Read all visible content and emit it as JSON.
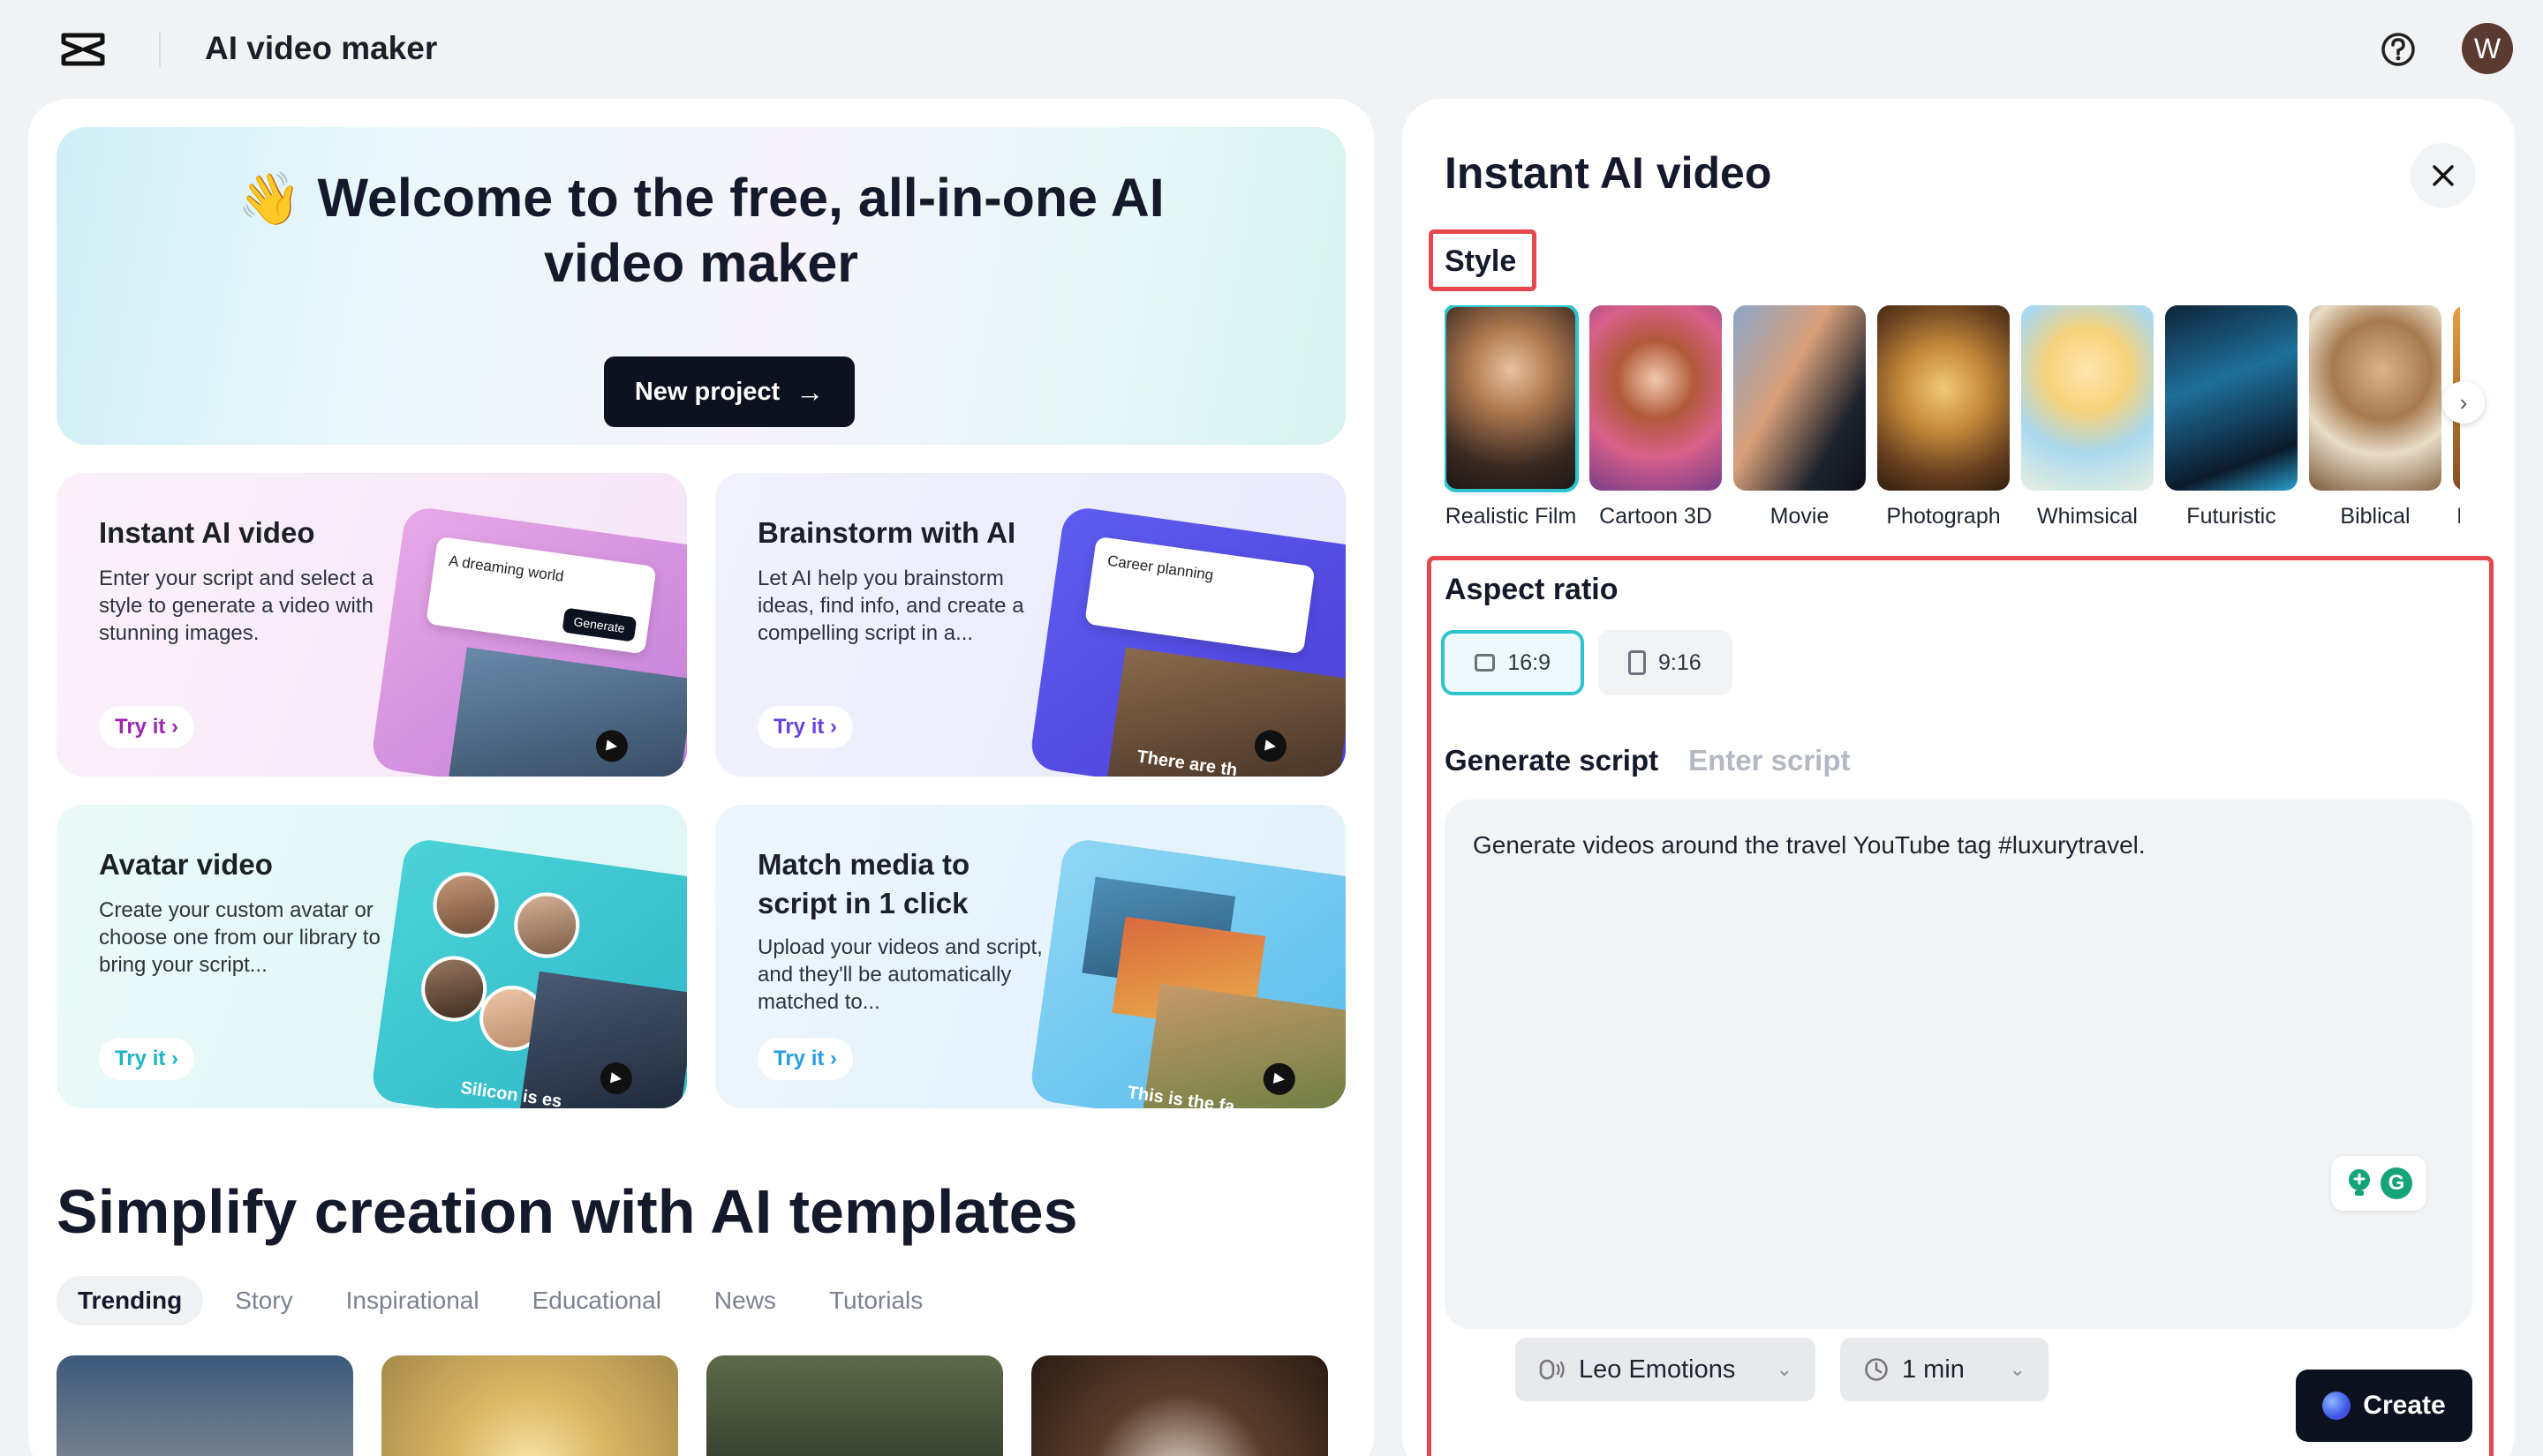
{
  "app": {
    "title": "AI video maker",
    "avatar_initial": "W"
  },
  "hero": {
    "wave_emoji": "👋",
    "title": "Welcome to the free, all-in-one AI video maker",
    "new_project_label": "New project"
  },
  "cards": [
    {
      "title": "Instant AI video",
      "desc": "Enter your script and select a style to generate a video with stunning images.",
      "try_label": "Try it",
      "mini_text": "A dreaming world",
      "mini_btn": "Generate"
    },
    {
      "title": "Brainstorm with AI",
      "desc": "Let AI help you brainstorm ideas, find info, and create a compelling script in a...",
      "try_label": "Try it",
      "mini_text": "Career planning",
      "caption": "There are th"
    },
    {
      "title": "Avatar video",
      "desc": "Create your custom avatar or choose one from our library to bring your script...",
      "try_label": "Try it",
      "caption": "Silicon is es"
    },
    {
      "title": "Match media to script in 1 click",
      "desc": "Upload your videos and script, and they'll be automatically matched to...",
      "try_label": "Try it",
      "caption": "This is the fa"
    }
  ],
  "templates": {
    "title": "Simplify creation with AI templates",
    "tabs": [
      "Trending",
      "Story",
      "Inspirational",
      "Educational",
      "News",
      "Tutorials"
    ],
    "active_tab": "Trending"
  },
  "panel": {
    "title": "Instant AI video",
    "style_label": "Style",
    "styles": [
      "Realistic Film",
      "Cartoon 3D",
      "Movie",
      "Photograph",
      "Whimsical",
      "Futuristic",
      "Biblical",
      "I"
    ],
    "selected_style": "Realistic Film",
    "aspect_label": "Aspect ratio",
    "ratios": [
      "16:9",
      "9:16"
    ],
    "selected_ratio": "16:9",
    "script_tabs": [
      "Generate script",
      "Enter script"
    ],
    "active_script_tab": "Generate script",
    "script_text": "Generate videos around the travel YouTube tag #luxurytravel.",
    "voice": "Leo Emotions",
    "duration": "1 min",
    "create_label": "Create"
  },
  "colors": {
    "highlight": "#e5484d",
    "accent": "#2ec4cf",
    "dark_button": "#0d1220"
  }
}
